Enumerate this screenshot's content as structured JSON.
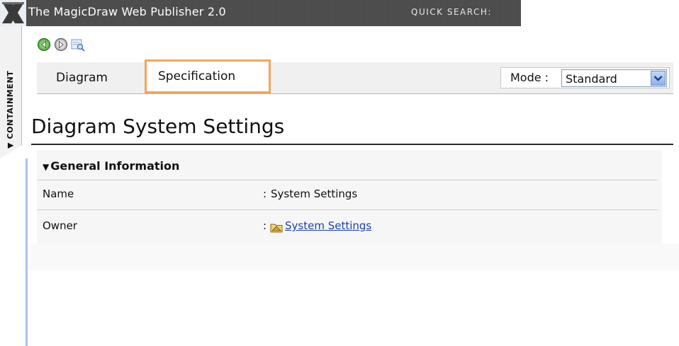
{
  "header": {
    "app_title": "The MagicDraw Web Publisher 2.0",
    "quick_search_label": "QUICK SEARCH:",
    "quick_search_value": ""
  },
  "sidebar": {
    "containment_label": "▼ CONTAINMENT"
  },
  "nav": {
    "back_icon": "back-arrow-icon",
    "forward_icon": "forward-arrow-icon",
    "zoom_icon": "zoom-icon"
  },
  "tabs": [
    {
      "label": "Diagram",
      "active": false
    },
    {
      "label": "Specification",
      "active": true
    }
  ],
  "mode": {
    "label": "Mode :",
    "selected": "Standard"
  },
  "page": {
    "title": "Diagram System Settings"
  },
  "general_info": {
    "heading": "General Information",
    "rows": [
      {
        "label": "Name",
        "colon": ":",
        "value": "System Settings",
        "link": false
      },
      {
        "label": "Owner",
        "colon": ":",
        "value": "System Settings",
        "link": true
      }
    ]
  },
  "colors": {
    "active_tab_border": "#f2a65a",
    "title_bar": "#4a4a4a",
    "link": "#1a3fae",
    "left_rule": "#aac4e6"
  }
}
